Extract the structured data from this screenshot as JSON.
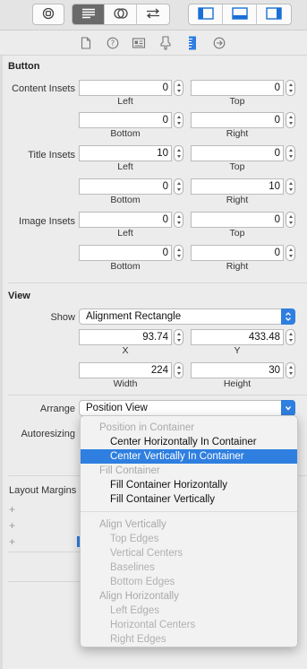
{
  "toolbar": {
    "buttons": [
      "history-icon",
      "editor-standard-icon",
      "editor-assistant-icon",
      "editor-version-icon",
      "navigator-toggle-icon",
      "debug-area-toggle-icon",
      "utilities-toggle-icon"
    ]
  },
  "inspector_tabs": [
    "file-icon",
    "help-icon",
    "identity-icon",
    "attributes-icon",
    "size-icon",
    "connections-icon"
  ],
  "button_section": {
    "title": "Button",
    "content_insets": {
      "label": "Content Insets",
      "left": "0",
      "top": "0",
      "bottom": "0",
      "right": "0",
      "left_label": "Left",
      "top_label": "Top",
      "bottom_label": "Bottom",
      "right_label": "Right"
    },
    "title_insets": {
      "label": "Title Insets",
      "left": "10",
      "top": "0",
      "bottom": "0",
      "right": "10",
      "left_label": "Left",
      "top_label": "Top",
      "bottom_label": "Bottom",
      "right_label": "Right"
    },
    "image_insets": {
      "label": "Image Insets",
      "left": "0",
      "top": "0",
      "bottom": "0",
      "right": "0",
      "left_label": "Left",
      "top_label": "Top",
      "bottom_label": "Bottom",
      "right_label": "Right"
    }
  },
  "view_section": {
    "title": "View",
    "show_label": "Show",
    "show_value": "Alignment Rectangle",
    "x": "93.74",
    "y": "433.48",
    "width": "224",
    "height": "30",
    "x_label": "X",
    "y_label": "Y",
    "width_label": "Width",
    "height_label": "Height",
    "arrange_label": "Arrange",
    "arrange_value": "Position View",
    "autoresizing_label": "Autoresizing",
    "layout_margins_label": "Layout Margins"
  },
  "arrange_menu": {
    "header_position": "Position in Container",
    "center_h": "Center Horizontally In Container",
    "center_v": "Center Vertically In Container",
    "header_fill": "Fill Container",
    "fill_h": "Fill Container Horizontally",
    "fill_v": "Fill Container Vertically",
    "header_align_v": "Align Vertically",
    "top_edges": "Top Edges",
    "vertical_centers": "Vertical Centers",
    "baselines": "Baselines",
    "bottom_edges": "Bottom Edges",
    "header_align_h": "Align Horizontally",
    "left_edges": "Left Edges",
    "horizontal_centers": "Horizontal Centers",
    "right_edges": "Right Edges"
  },
  "colors": {
    "accent": "#2f7fe0",
    "panel": "#ececec"
  }
}
